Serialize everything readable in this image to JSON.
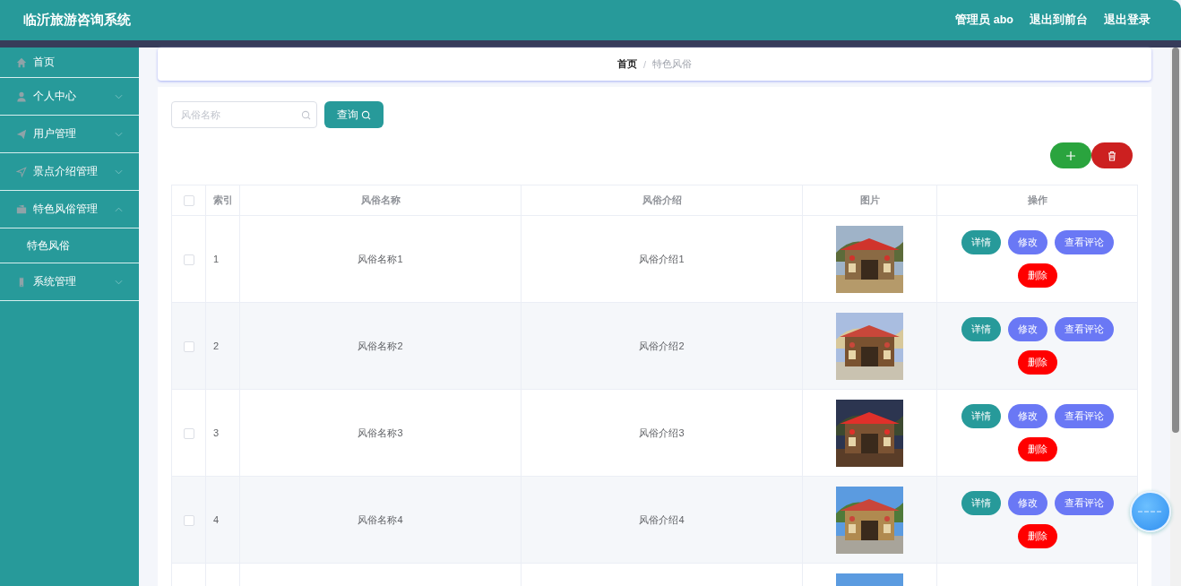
{
  "header": {
    "title": "临沂旅游咨询系统",
    "user": "管理员 abo",
    "links": [
      "退出到前台",
      "退出登录"
    ]
  },
  "sidebar": {
    "items": [
      {
        "label": "首页",
        "kind": "link"
      },
      {
        "label": "个人中心",
        "kind": "menu",
        "expanded": false
      },
      {
        "label": "用户管理",
        "kind": "menu",
        "expanded": false
      },
      {
        "label": "景点介绍管理",
        "kind": "menu",
        "expanded": false
      },
      {
        "label": "特色风俗管理",
        "kind": "menu",
        "expanded": true,
        "children": [
          {
            "label": "特色风俗"
          }
        ]
      },
      {
        "label": "系统管理",
        "kind": "menu",
        "expanded": false
      }
    ]
  },
  "breadcrumb": {
    "items": [
      "首页",
      "特色风俗"
    ],
    "separator": "/"
  },
  "search": {
    "placeholder": "风俗名称",
    "button": "查询"
  },
  "table": {
    "columns": [
      "索引",
      "风俗名称",
      "风俗介绍",
      "图片",
      "操作"
    ],
    "all_checked": false,
    "rows": [
      {
        "index": "1",
        "name": "风俗名称1",
        "intro": "风俗介绍1",
        "checked": false,
        "actions": [
          {
            "label": "详情",
            "kind": "detail"
          },
          {
            "label": "修改",
            "kind": "edit"
          },
          {
            "label": "查看评论",
            "kind": "comment"
          },
          {
            "label": "删除",
            "kind": "delete"
          }
        ]
      },
      {
        "index": "2",
        "name": "风俗名称2",
        "intro": "风俗介绍2",
        "checked": false,
        "actions": [
          {
            "label": "详情",
            "kind": "detail"
          },
          {
            "label": "修改",
            "kind": "edit"
          },
          {
            "label": "查看评论",
            "kind": "comment"
          },
          {
            "label": "删除",
            "kind": "delete"
          }
        ]
      },
      {
        "index": "3",
        "name": "风俗名称3",
        "intro": "风俗介绍3",
        "checked": false,
        "actions": [
          {
            "label": "详情",
            "kind": "detail"
          },
          {
            "label": "修改",
            "kind": "edit"
          },
          {
            "label": "查看评论",
            "kind": "comment"
          },
          {
            "label": "删除",
            "kind": "delete"
          }
        ]
      },
      {
        "index": "4",
        "name": "风俗名称4",
        "intro": "风俗介绍4",
        "checked": false,
        "actions": [
          {
            "label": "详情",
            "kind": "detail"
          },
          {
            "label": "修改",
            "kind": "edit"
          },
          {
            "label": "查看评论",
            "kind": "comment"
          },
          {
            "label": "删除",
            "kind": "delete"
          }
        ]
      },
      {
        "kind": "partial"
      }
    ]
  }
}
